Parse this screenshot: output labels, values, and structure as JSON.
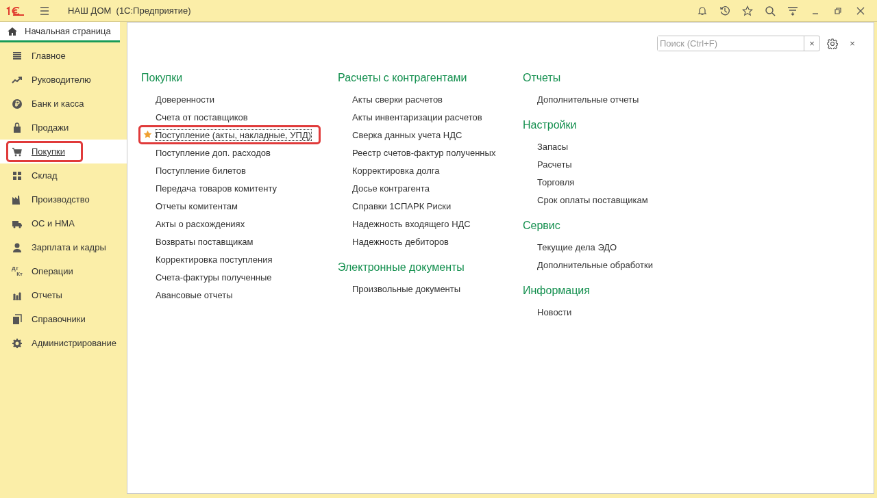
{
  "window": {
    "title": "НАШ ДОМ  (1С:Предприятие)"
  },
  "home_tab": {
    "label": "Начальная страница",
    "selected": true
  },
  "sidebar": {
    "items": [
      {
        "label": "Главное",
        "selected": false,
        "highlighted": false
      },
      {
        "label": "Руководителю",
        "selected": false,
        "highlighted": false
      },
      {
        "label": "Банк и касса",
        "selected": false,
        "highlighted": false
      },
      {
        "label": "Продажи",
        "selected": false,
        "highlighted": false
      },
      {
        "label": "Покупки",
        "selected": true,
        "highlighted": true
      },
      {
        "label": "Склад",
        "selected": false,
        "highlighted": false
      },
      {
        "label": "Производство",
        "selected": false,
        "highlighted": false
      },
      {
        "label": "ОС и НМА",
        "selected": false,
        "highlighted": false
      },
      {
        "label": "Зарплата и кадры",
        "selected": false,
        "highlighted": false
      },
      {
        "label": "Операции",
        "selected": false,
        "highlighted": false,
        "icon_text": [
          "Дт",
          "Кт"
        ]
      },
      {
        "label": "Отчеты",
        "selected": false,
        "highlighted": false
      },
      {
        "label": "Справочники",
        "selected": false,
        "highlighted": false
      },
      {
        "label": "Администрирование",
        "selected": false,
        "highlighted": false
      }
    ]
  },
  "search": {
    "placeholder": "Поиск (Ctrl+F)",
    "clear": "×"
  },
  "panel_close": "×",
  "columns": [
    [
      {
        "title": "Покупки",
        "links": [
          {
            "label": "Доверенности",
            "favorite": false,
            "highlighted": false
          },
          {
            "label": "Счета от поставщиков",
            "favorite": false,
            "highlighted": false
          },
          {
            "label": "Поступление (акты, накладные, УПД)",
            "favorite": true,
            "highlighted": true
          },
          {
            "label": "Поступление доп. расходов",
            "favorite": false,
            "highlighted": false
          },
          {
            "label": "Поступление билетов",
            "favorite": false,
            "highlighted": false
          },
          {
            "label": "Передача товаров комитенту",
            "favorite": false,
            "highlighted": false
          },
          {
            "label": "Отчеты комитентам",
            "favorite": false,
            "highlighted": false
          },
          {
            "label": "Акты о расхождениях",
            "favorite": false,
            "highlighted": false
          },
          {
            "label": "Возвраты поставщикам",
            "favorite": false,
            "highlighted": false
          },
          {
            "label": "Корректировка поступления",
            "favorite": false,
            "highlighted": false
          },
          {
            "label": "Счета-фактуры полученные",
            "favorite": false,
            "highlighted": false
          },
          {
            "label": "Авансовые отчеты",
            "favorite": false,
            "highlighted": false
          }
        ]
      }
    ],
    [
      {
        "title": "Расчеты с контрагентами",
        "links": [
          {
            "label": "Акты сверки расчетов",
            "favorite": false,
            "highlighted": false
          },
          {
            "label": "Акты инвентаризации расчетов",
            "favorite": false,
            "highlighted": false
          },
          {
            "label": "Сверка данных учета НДС",
            "favorite": false,
            "highlighted": false
          },
          {
            "label": "Реестр счетов-фактур полученных",
            "favorite": false,
            "highlighted": false
          },
          {
            "label": "Корректировка долга",
            "favorite": false,
            "highlighted": false
          },
          {
            "label": "Досье контрагента",
            "favorite": false,
            "highlighted": false
          },
          {
            "label": "Справки 1СПАРК Риски",
            "favorite": false,
            "highlighted": false
          },
          {
            "label": "Надежность входящего НДС",
            "favorite": false,
            "highlighted": false
          },
          {
            "label": "Надежность дебиторов",
            "favorite": false,
            "highlighted": false
          }
        ]
      },
      {
        "title": "Электронные документы",
        "links": [
          {
            "label": "Произвольные документы",
            "favorite": false,
            "highlighted": false
          }
        ]
      }
    ],
    [
      {
        "title": "Отчеты",
        "links": [
          {
            "label": "Дополнительные отчеты",
            "favorite": false,
            "highlighted": false
          }
        ]
      },
      {
        "title": "Настройки",
        "links": [
          {
            "label": "Запасы",
            "favorite": false,
            "highlighted": false
          },
          {
            "label": "Расчеты",
            "favorite": false,
            "highlighted": false
          },
          {
            "label": "Торговля",
            "favorite": false,
            "highlighted": false
          },
          {
            "label": "Срок оплаты поставщикам",
            "favorite": false,
            "highlighted": false
          }
        ]
      },
      {
        "title": "Сервис",
        "links": [
          {
            "label": "Текущие дела ЭДО",
            "favorite": false,
            "highlighted": false
          },
          {
            "label": "Дополнительные обработки",
            "favorite": false,
            "highlighted": false
          }
        ]
      },
      {
        "title": "Информация",
        "links": [
          {
            "label": "Новости",
            "favorite": false,
            "highlighted": false
          }
        ]
      }
    ]
  ]
}
